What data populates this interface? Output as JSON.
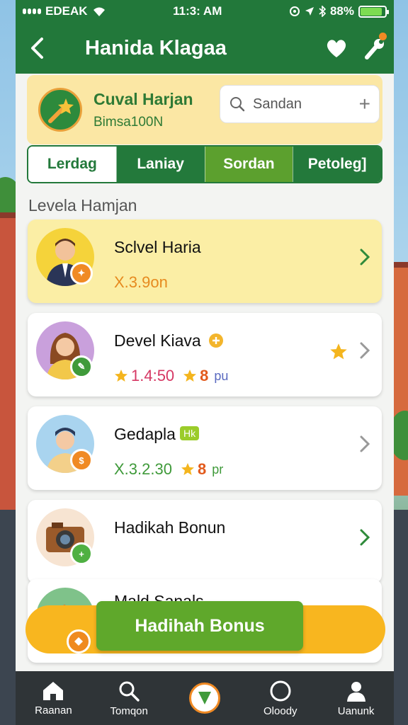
{
  "status_bar": {
    "carrier": "EDEAK",
    "time": "11:3: AM",
    "battery": "88%"
  },
  "header": {
    "title": "Hanida Klagaa"
  },
  "banner": {
    "title": "Cuval Harjan",
    "subtitle": "Bimsa100N",
    "search_placeholder": "Sandan"
  },
  "tabs": [
    {
      "label": "Lerdag",
      "active": true
    },
    {
      "label": "Laniay",
      "active": false
    },
    {
      "label": "Sordan",
      "active": false
    },
    {
      "label": "Petoleg]",
      "active": false
    }
  ],
  "section_title": "Levela Hamjan",
  "items": [
    {
      "name": "Sclvel Haria",
      "value": "X.3.9on",
      "value_color": "#e68a1f"
    },
    {
      "name": "Devel Kiava",
      "value": "1.4:50",
      "value_color": "#d63864",
      "points": "8",
      "unit": "pu"
    },
    {
      "name": "Gedapla",
      "tag": "Hk",
      "value": "X.3.2.30",
      "value_color": "#3f9a3a",
      "points": "8",
      "unit": "pr"
    },
    {
      "name": "Hadikah Bonun"
    },
    {
      "name": "Mald Sanals"
    }
  ],
  "bonus_button": "Hadihah Bonus",
  "bottom_nav": [
    {
      "label": "Raanan",
      "icon": "home-icon"
    },
    {
      "label": "Tomqon",
      "icon": "search-icon"
    },
    {
      "label": "",
      "icon": "center-action-icon"
    },
    {
      "label": "Oloody",
      "icon": "circle-icon"
    },
    {
      "label": "Uanunk",
      "icon": "profile-icon"
    }
  ],
  "colors": {
    "primary_green": "#22783a",
    "light_green": "#5fa82b",
    "highlight_yellow": "#fbeea5",
    "accent_orange": "#f08a24"
  }
}
